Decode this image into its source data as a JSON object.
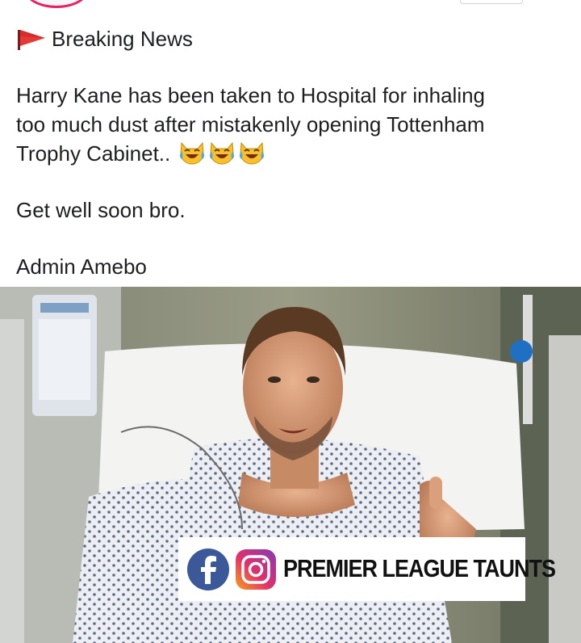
{
  "post": {
    "headline": "Breaking News",
    "body_lines": [
      "Harry Kane has been taken to Hospital for inhaling",
      "too much dust after mistakenly opening Tottenham",
      "Trophy Cabinet.."
    ],
    "line2": "Get well soon bro.",
    "signature": "Admin Amebo",
    "emoji_names": [
      "cat-tears-of-joy-icon",
      "cat-tears-of-joy-icon",
      "cat-tears-of-joy-icon"
    ],
    "flag_icon": "triangular-red-flag-icon"
  },
  "photo": {
    "watermark_text": "PREMIER LEAGUE TAUNTS",
    "watermark_icons": [
      "facebook-icon",
      "instagram-icon"
    ]
  },
  "colors": {
    "flag": "#e53935",
    "avatar_ring": "#e91e63",
    "facebook": "#3b5998"
  }
}
